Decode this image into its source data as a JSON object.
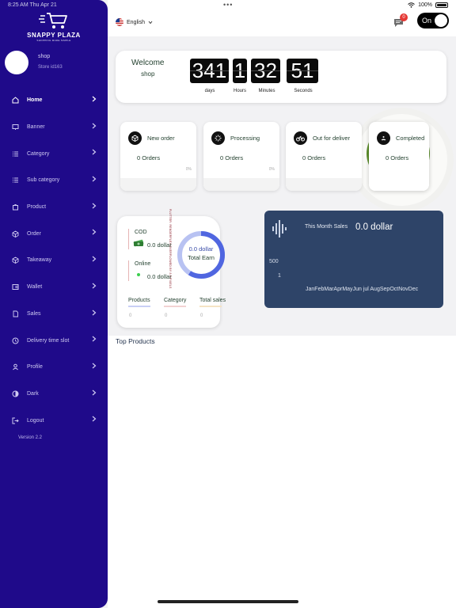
{
  "status_bar": {
    "time": "8:25 AM   Thu Apr 21",
    "battery": "100%"
  },
  "brand": {
    "name": "SNAPPY PLAZA",
    "tagline": "SHOPPING MADE SIMPLE"
  },
  "store": {
    "name": "shop",
    "id": "Store id163"
  },
  "nav": [
    {
      "label": "Home",
      "icon": "home-icon"
    },
    {
      "label": "Banner",
      "icon": "monitor-icon"
    },
    {
      "label": "Category",
      "icon": "list-icon"
    },
    {
      "label": "Sub category",
      "icon": "list-icon"
    },
    {
      "label": "Product",
      "icon": "bag-icon"
    },
    {
      "label": "Order",
      "icon": "box-icon"
    },
    {
      "label": "Takeaway",
      "icon": "box-icon"
    },
    {
      "label": "Wallet",
      "icon": "wallet-icon"
    },
    {
      "label": "Sales",
      "icon": "document-icon"
    },
    {
      "label": "Delivery time slot",
      "icon": "clock-icon"
    },
    {
      "label": "Profile",
      "icon": "user-icon"
    },
    {
      "label": "Dark",
      "icon": "contrast-icon"
    },
    {
      "label": "Logout",
      "icon": "logout-icon"
    }
  ],
  "version": "Version 2.2",
  "header": {
    "language": "English",
    "notification_count": "0",
    "toggle_label": "On"
  },
  "welcome": {
    "line1": "Welcome",
    "line2": "shop"
  },
  "countdown": {
    "days": "341",
    "hours": "1",
    "minutes": "32",
    "seconds": "51",
    "days_label": "days",
    "hours_label": "Hours",
    "minutes_label": "Minutes",
    "seconds_label": "Seconds"
  },
  "order_status": [
    {
      "title": "New order",
      "count": "0 Orders",
      "percent": "0%"
    },
    {
      "title": "Processing",
      "count": "0 Orders",
      "percent": "0%"
    },
    {
      "title": "Out for deliver",
      "count": "0 Orders",
      "percent": ""
    },
    {
      "title": "Completed",
      "count": "0 Orders",
      "percent": ""
    }
  ],
  "earnings": {
    "cod_label": "COD",
    "cod_value": "0.0 dollar",
    "online_label": "Online",
    "online_value": "0.0 dollar",
    "total_value": "0.0 dollar",
    "total_label": "Total Earn",
    "side_note": "FLUTTER: RENDERFLEX OVERFLOWED BY 8.9 PIXELS",
    "tabs": [
      {
        "label": "Products",
        "value": "0"
      },
      {
        "label": "Category",
        "value": "0"
      },
      {
        "label": "Total sales",
        "value": "0"
      }
    ]
  },
  "sales": {
    "title": "This Month Sales",
    "value": "0.0 dollar"
  },
  "chart_data": {
    "type": "line",
    "title": "This Month Sales",
    "categories": [
      "Jan",
      "Feb",
      "Mar",
      "Apr",
      "May",
      "Jun",
      "jul",
      "Aug",
      "Sep",
      "Oct",
      "Nov",
      "Dec"
    ],
    "y_ticks": [
      "500",
      "1"
    ],
    "series": [],
    "grid": false
  },
  "top_products": {
    "title": "Top Products"
  },
  "colors": {
    "sidebar": "#1f0a8a",
    "sales_card": "#2e4468",
    "badge": "#e53935"
  }
}
